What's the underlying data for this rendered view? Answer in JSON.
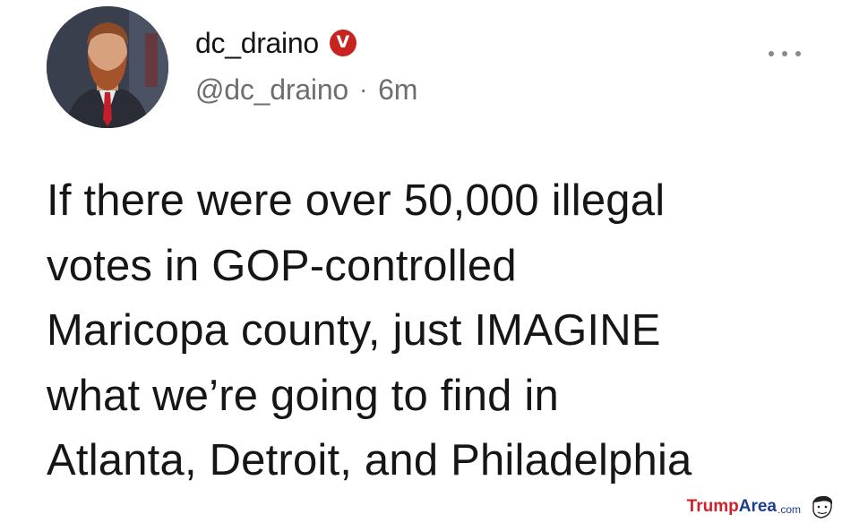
{
  "post": {
    "display_name": "dc_draino",
    "verified_mark": "V",
    "handle": "@dc_draino",
    "separator": "·",
    "time": "6m",
    "text_lines": [
      "If there were over 50,000 illegal",
      "votes in GOP-controlled",
      "Maricopa county, just IMAGINE",
      "what we’re going to find in",
      "Atlanta, Detroit, and Philadelphia"
    ]
  },
  "watermark": {
    "part1": "Trump",
    "part2": "Area",
    "part3": ".com"
  },
  "colors": {
    "badge": "#c8241f",
    "meta": "#6e6e6e",
    "watermark_red": "#d0202a",
    "watermark_blue": "#1e3d8f"
  },
  "icons": {
    "avatar": "profile-photo",
    "verified": "verified-badge-icon",
    "more": "more-options-icon",
    "watermark_face": "cartoon-face-icon"
  }
}
